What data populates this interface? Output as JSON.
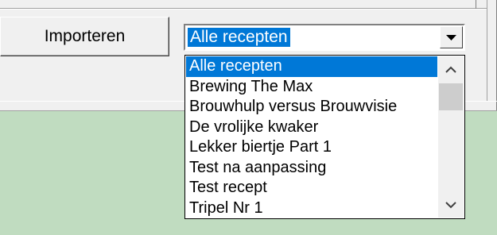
{
  "import_button": {
    "label": "Importeren"
  },
  "recipe_combo": {
    "selected_value": "Alle recepten",
    "dropdown_arrow_icon": "triangle-down"
  },
  "recipe_list": {
    "items": [
      {
        "label": "Alle recepten",
        "selected": true
      },
      {
        "label": "Brewing The Max",
        "selected": false
      },
      {
        "label": "Brouwhulp versus Brouwvisie",
        "selected": false
      },
      {
        "label": "De vrolijke kwaker",
        "selected": false
      },
      {
        "label": "Lekker biertje Part 1",
        "selected": false
      },
      {
        "label": "Test na aanpassing",
        "selected": false
      },
      {
        "label": "Test recept",
        "selected": false
      },
      {
        "label": "Tripel Nr 1",
        "selected": false
      }
    ],
    "scrollbar": {
      "up_icon": "chevron-up",
      "down_icon": "chevron-down",
      "position": 0
    }
  },
  "colors": {
    "selection": "#0078d7",
    "panel": "#f0f0f0",
    "background": "#c0dcc0"
  }
}
